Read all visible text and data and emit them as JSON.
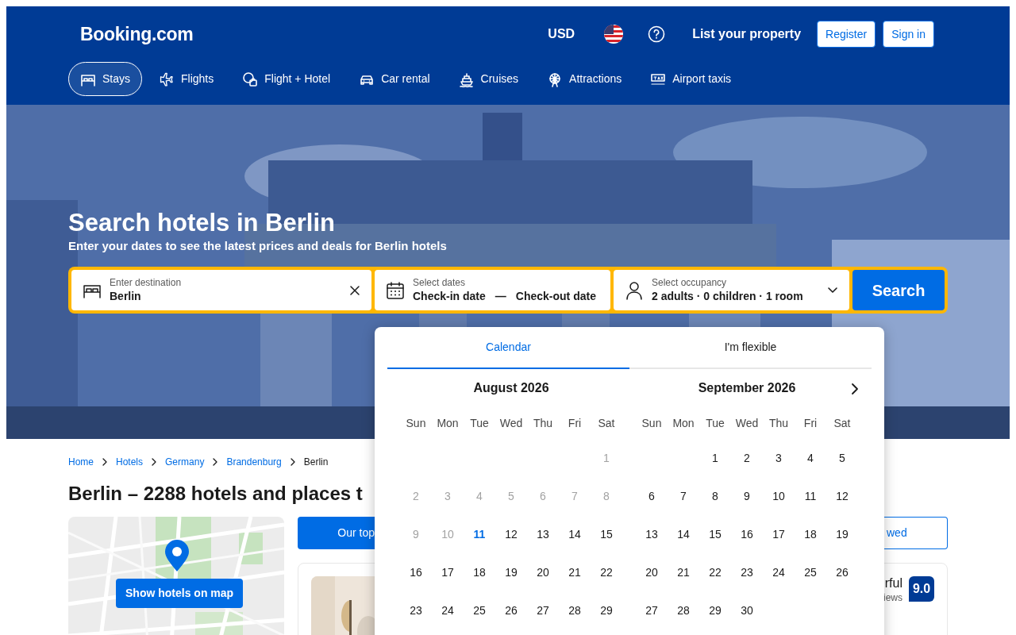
{
  "header": {
    "logo": "Booking.com",
    "currency": "USD",
    "list_property": "List your property",
    "buttons": [
      "Register",
      "Sign in"
    ]
  },
  "nav_tabs": [
    {
      "label": "Stays",
      "selected": true
    },
    {
      "label": "Flights",
      "selected": false
    },
    {
      "label": "Flight + Hotel",
      "selected": false
    },
    {
      "label": "Car rental",
      "selected": false
    },
    {
      "label": "Cruises",
      "selected": false
    },
    {
      "label": "Attractions",
      "selected": false
    },
    {
      "label": "Airport taxis",
      "selected": false
    }
  ],
  "hero": {
    "title": "Search hotels in Berlin",
    "subtitle": "Enter your dates to see the latest prices and deals for Berlin hotels"
  },
  "search_bar": {
    "destination": {
      "label": "Enter destination",
      "value": "Berlin"
    },
    "dates": {
      "label": "Select dates",
      "check_in": "Check-in date",
      "separator": "—",
      "check_out": "Check-out date"
    },
    "occupancy": {
      "label": "Select occupancy",
      "value": "2 adults · 0 children · 1 room"
    },
    "button": "Search"
  },
  "breadcrumbs": [
    {
      "label": "Home",
      "current": false
    },
    {
      "label": "Hotels",
      "current": false
    },
    {
      "label": "Germany",
      "current": false
    },
    {
      "label": "Brandenburg",
      "current": false
    },
    {
      "label": "Berlin",
      "current": true
    }
  ],
  "heading": "Berlin – 2288 hotels and places t",
  "map": {
    "button": "Show hotels on map"
  },
  "result_tabs": [
    {
      "label": "Our top",
      "selected": true
    },
    {
      "label": "wed",
      "selected": false
    }
  ],
  "hotel_card": {
    "rating_word": "rful",
    "reviews": "iews",
    "score": "9.0"
  },
  "calendar": {
    "tabs": [
      {
        "label": "Calendar",
        "selected": true
      },
      {
        "label": "I'm flexible",
        "selected": false
      }
    ],
    "months": [
      {
        "title": "August 2026",
        "weekdays": [
          "Sun",
          "Mon",
          "Tue",
          "Wed",
          "Thu",
          "Fri",
          "Sat"
        ],
        "days": [
          {
            "kind": "blank"
          },
          {
            "kind": "blank"
          },
          {
            "kind": "blank"
          },
          {
            "kind": "blank"
          },
          {
            "kind": "blank"
          },
          {
            "kind": "blank"
          },
          {
            "kind": "day",
            "day": "1",
            "disabled": true,
            "today": false
          },
          {
            "kind": "day",
            "day": "2",
            "disabled": true,
            "today": false
          },
          {
            "kind": "day",
            "day": "3",
            "disabled": true,
            "today": false
          },
          {
            "kind": "day",
            "day": "4",
            "disabled": true,
            "today": false
          },
          {
            "kind": "day",
            "day": "5",
            "disabled": true,
            "today": false
          },
          {
            "kind": "day",
            "day": "6",
            "disabled": true,
            "today": false
          },
          {
            "kind": "day",
            "day": "7",
            "disabled": true,
            "today": false
          },
          {
            "kind": "day",
            "day": "8",
            "disabled": true,
            "today": false
          },
          {
            "kind": "day",
            "day": "9",
            "disabled": true,
            "today": false
          },
          {
            "kind": "day",
            "day": "10",
            "disabled": true,
            "today": false
          },
          {
            "kind": "day",
            "day": "11",
            "disabled": false,
            "today": true
          },
          {
            "kind": "day",
            "day": "12",
            "disabled": false,
            "today": false
          },
          {
            "kind": "day",
            "day": "13",
            "disabled": false,
            "today": false
          },
          {
            "kind": "day",
            "day": "14",
            "disabled": false,
            "today": false
          },
          {
            "kind": "day",
            "day": "15",
            "disabled": false,
            "today": false
          },
          {
            "kind": "day",
            "day": "16",
            "disabled": false,
            "today": false
          },
          {
            "kind": "day",
            "day": "17",
            "disabled": false,
            "today": false
          },
          {
            "kind": "day",
            "day": "18",
            "disabled": false,
            "today": false
          },
          {
            "kind": "day",
            "day": "19",
            "disabled": false,
            "today": false
          },
          {
            "kind": "day",
            "day": "20",
            "disabled": false,
            "today": false
          },
          {
            "kind": "day",
            "day": "21",
            "disabled": false,
            "today": false
          },
          {
            "kind": "day",
            "day": "22",
            "disabled": false,
            "today": false
          },
          {
            "kind": "day",
            "day": "23",
            "disabled": false,
            "today": false
          },
          {
            "kind": "day",
            "day": "24",
            "disabled": false,
            "today": false
          },
          {
            "kind": "day",
            "day": "25",
            "disabled": false,
            "today": false
          },
          {
            "kind": "day",
            "day": "26",
            "disabled": false,
            "today": false
          },
          {
            "kind": "day",
            "day": "27",
            "disabled": false,
            "today": false
          },
          {
            "kind": "day",
            "day": "28",
            "disabled": false,
            "today": false
          },
          {
            "kind": "day",
            "day": "29",
            "disabled": false,
            "today": false
          }
        ]
      },
      {
        "title": "September 2026",
        "weekdays": [
          "Sun",
          "Mon",
          "Tue",
          "Wed",
          "Thu",
          "Fri",
          "Sat"
        ],
        "days": [
          {
            "kind": "blank"
          },
          {
            "kind": "blank"
          },
          {
            "kind": "day",
            "day": "1",
            "disabled": false,
            "today": false
          },
          {
            "kind": "day",
            "day": "2",
            "disabled": false,
            "today": false
          },
          {
            "kind": "day",
            "day": "3",
            "disabled": false,
            "today": false
          },
          {
            "kind": "day",
            "day": "4",
            "disabled": false,
            "today": false
          },
          {
            "kind": "day",
            "day": "5",
            "disabled": false,
            "today": false
          },
          {
            "kind": "day",
            "day": "6",
            "disabled": false,
            "today": false
          },
          {
            "kind": "day",
            "day": "7",
            "disabled": false,
            "today": false
          },
          {
            "kind": "day",
            "day": "8",
            "disabled": false,
            "today": false
          },
          {
            "kind": "day",
            "day": "9",
            "disabled": false,
            "today": false
          },
          {
            "kind": "day",
            "day": "10",
            "disabled": false,
            "today": false
          },
          {
            "kind": "day",
            "day": "11",
            "disabled": false,
            "today": false
          },
          {
            "kind": "day",
            "day": "12",
            "disabled": false,
            "today": false
          },
          {
            "kind": "day",
            "day": "13",
            "disabled": false,
            "today": false
          },
          {
            "kind": "day",
            "day": "14",
            "disabled": false,
            "today": false
          },
          {
            "kind": "day",
            "day": "15",
            "disabled": false,
            "today": false
          },
          {
            "kind": "day",
            "day": "16",
            "disabled": false,
            "today": false
          },
          {
            "kind": "day",
            "day": "17",
            "disabled": false,
            "today": false
          },
          {
            "kind": "day",
            "day": "18",
            "disabled": false,
            "today": false
          },
          {
            "kind": "day",
            "day": "19",
            "disabled": false,
            "today": false
          },
          {
            "kind": "day",
            "day": "20",
            "disabled": false,
            "today": false
          },
          {
            "kind": "day",
            "day": "21",
            "disabled": false,
            "today": false
          },
          {
            "kind": "day",
            "day": "22",
            "disabled": false,
            "today": false
          },
          {
            "kind": "day",
            "day": "23",
            "disabled": false,
            "today": false
          },
          {
            "kind": "day",
            "day": "24",
            "disabled": false,
            "today": false
          },
          {
            "kind": "day",
            "day": "25",
            "disabled": false,
            "today": false
          },
          {
            "kind": "day",
            "day": "26",
            "disabled": false,
            "today": false
          },
          {
            "kind": "day",
            "day": "27",
            "disabled": false,
            "today": false
          },
          {
            "kind": "day",
            "day": "28",
            "disabled": false,
            "today": false
          },
          {
            "kind": "day",
            "day": "29",
            "disabled": false,
            "today": false
          },
          {
            "kind": "day",
            "day": "30",
            "disabled": false,
            "today": false
          }
        ]
      }
    ]
  }
}
